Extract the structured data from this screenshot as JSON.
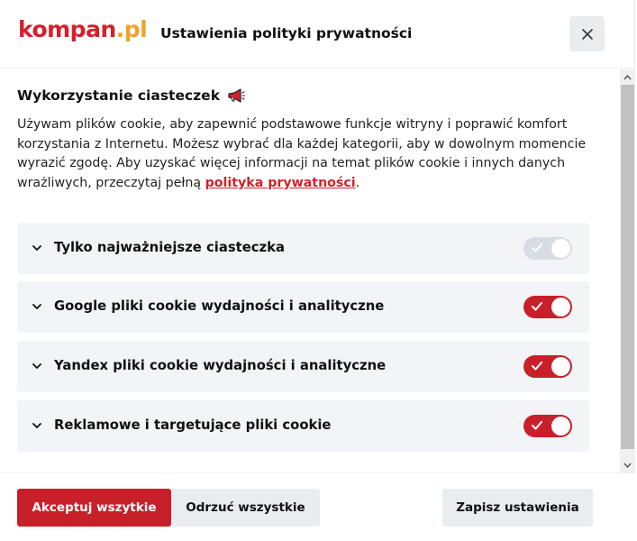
{
  "header": {
    "logo_main": "kompan",
    "logo_dot": ".pl",
    "title": "Ustawienia polityki prywatności",
    "close_icon": "close-icon"
  },
  "section": {
    "title": "Wykorzystanie ciasteczek",
    "title_icon": "megaphone-icon",
    "description_text": "Używam plików cookie, aby zapewnić podstawowe funkcje witryny i poprawić komfort korzystania z Internetu. Możesz wybrać dla każdej kategorii, aby w dowolnym momencie wyrazić zgodę. Aby uzyskać więcej informacji na temat plików cookie i innych danych wrażliwych, przeczytaj pełną ",
    "link_text": "polityka prywatności",
    "description_end": "."
  },
  "categories": [
    {
      "label": "Tylko najważniejsze ciasteczka",
      "enabled": true,
      "locked": true
    },
    {
      "label": "Google pliki cookie wydajności i analityczne",
      "enabled": true,
      "locked": false
    },
    {
      "label": "Yandex pliki cookie wydajności i analityczne",
      "enabled": true,
      "locked": false
    },
    {
      "label": "Reklamowe i targetujące pliki cookie",
      "enabled": true,
      "locked": false
    }
  ],
  "footer": {
    "accept_all": "Akceptuj wszytkie",
    "reject_all": "Odrzuć wszystkie",
    "save": "Zapisz ustawienia"
  },
  "colors": {
    "brand_red": "#c8202a",
    "brand_orange": "#f0a22e",
    "panel_bg": "#f2f4f7"
  }
}
